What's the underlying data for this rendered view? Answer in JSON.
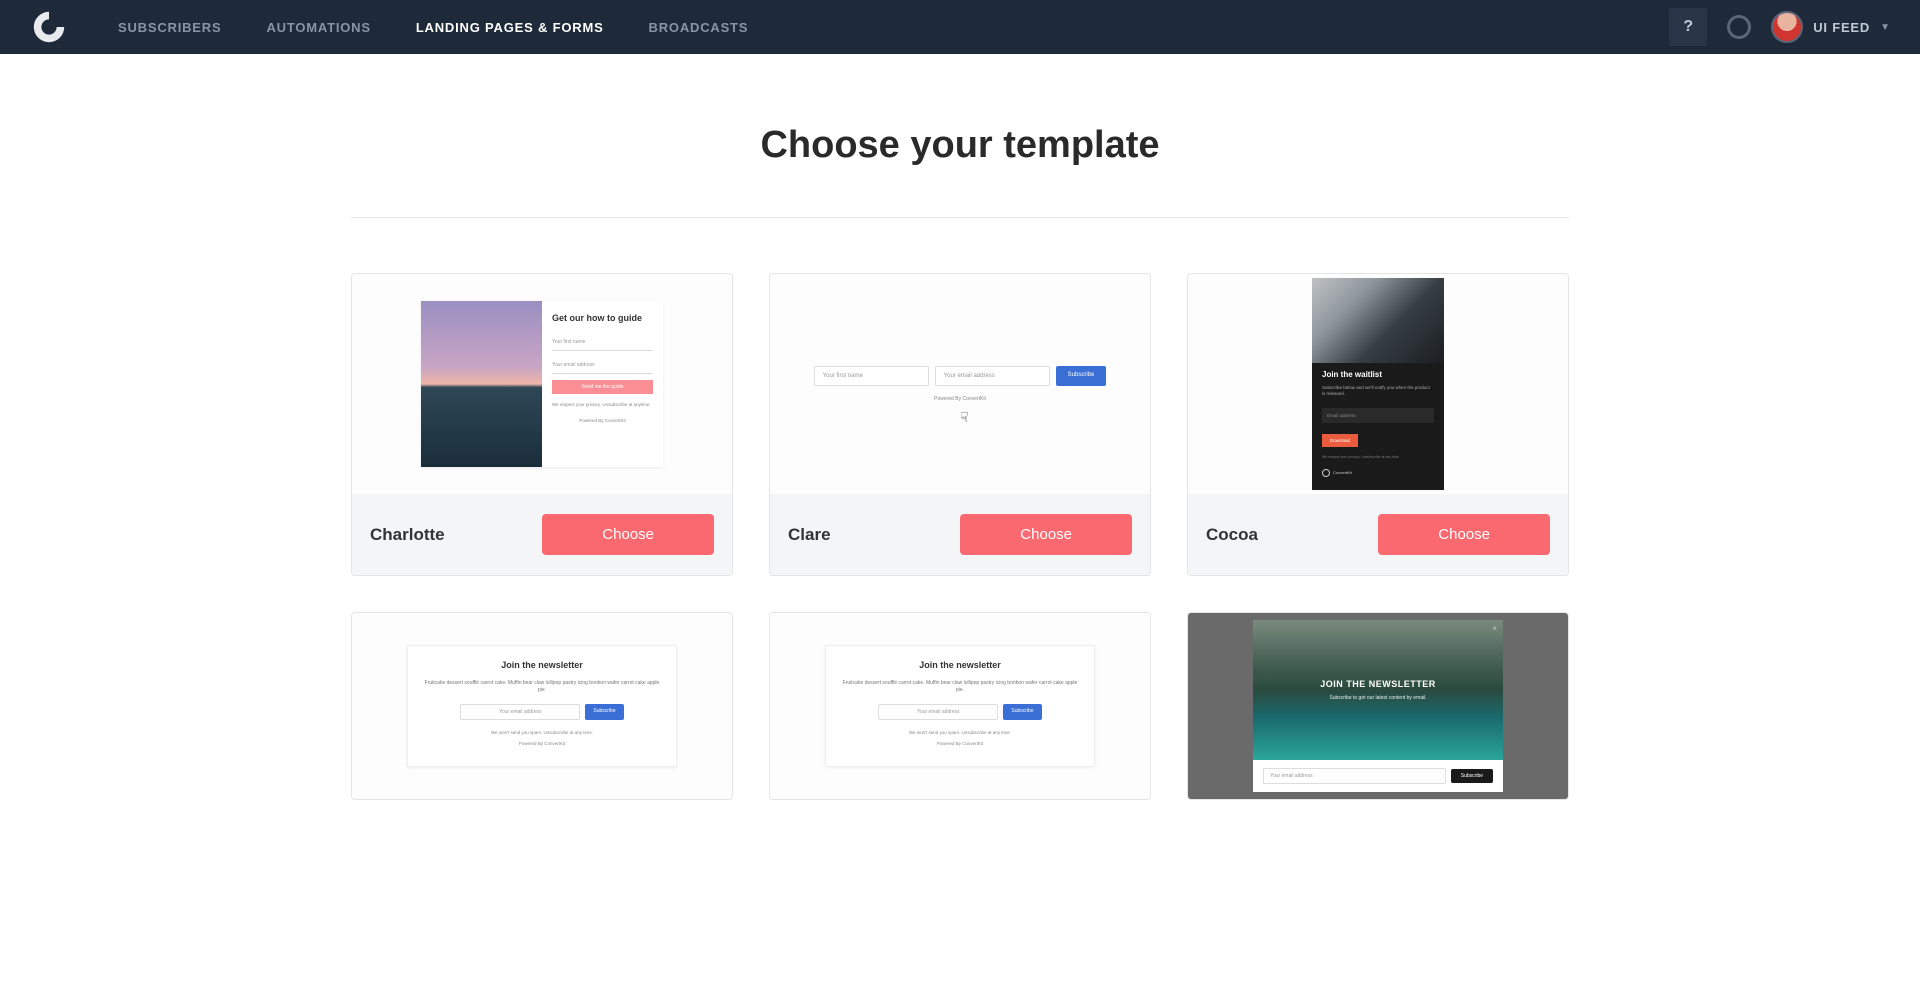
{
  "header": {
    "nav": [
      {
        "label": "SUBSCRIBERS",
        "active": false
      },
      {
        "label": "AUTOMATIONS",
        "active": false
      },
      {
        "label": "LANDING PAGES & FORMS",
        "active": true
      },
      {
        "label": "BROADCASTS",
        "active": false
      }
    ],
    "help_label": "?",
    "user_label": "UI FEED"
  },
  "page_title": "Choose your template",
  "choose_label": "Choose",
  "templates": [
    {
      "name": "Charlotte",
      "preview": {
        "title": "Get our how to guide",
        "input1": "Your first name",
        "input2": "Your email address",
        "button": "Send me the guide",
        "privacy": "We respect your privacy. Unsubscribe at anytime.",
        "powered": "Powered By ConvertKit"
      }
    },
    {
      "name": "Clare",
      "preview": {
        "input1": "Your first name",
        "input2": "Your email address",
        "button": "Subscribe",
        "powered": "Powered By ConvertKit"
      }
    },
    {
      "name": "Cocoa",
      "preview": {
        "title": "Join the waitlist",
        "subtitle": "Subscribe below and we'll notify you when the product is released.",
        "input1": "Email address",
        "button": "Download",
        "privacy": "We respect your privacy. Unsubscribe at any time.",
        "brand": "ConvertKit"
      }
    },
    {
      "name": "",
      "preview": {
        "title": "Join the newsletter",
        "body": "Fruitcake dessert soufflé carrot cake. Muffin bear claw lollipop pastry icing bonbon wafer carrot cake apple pie.",
        "input1": "Your email address",
        "button": "Subscribe",
        "spam": "We won't send you spam. Unsubscribe at any time.",
        "powered": "Powered By ConvertKit"
      }
    },
    {
      "name": "",
      "preview": {
        "title": "Join the newsletter",
        "body": "Fruitcake dessert soufflé carrot cake. Muffin bear claw lollipop pastry icing bonbon wafer carrot cake apple pie.",
        "input1": "Your email address",
        "button": "Subscribe",
        "spam": "We won't send you spam. Unsubscribe at any time.",
        "powered": "Powered By ConvertKit"
      }
    },
    {
      "name": "",
      "preview": {
        "title": "JOIN THE NEWSLETTER",
        "subtitle": "Subscribe to get our latest content by email.",
        "input1": "Your email address",
        "button": "Subscribe"
      }
    }
  ]
}
